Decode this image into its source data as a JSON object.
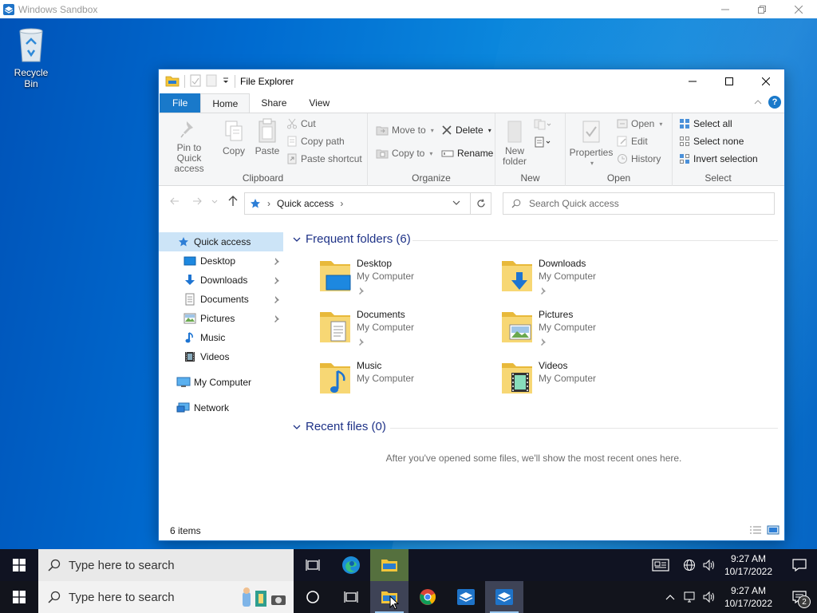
{
  "host": {
    "title": "Windows Sandbox",
    "controls": [
      "minimize",
      "restore",
      "close"
    ]
  },
  "desktop": {
    "icons": [
      {
        "label": "Recycle Bin",
        "icon": "recycle-bin-icon"
      }
    ]
  },
  "explorer": {
    "title": "File Explorer",
    "tabs": [
      "File",
      "Home",
      "Share",
      "View"
    ],
    "active_tab": "Home",
    "ribbon": {
      "clipboard": {
        "name": "Clipboard",
        "pin": "Pin to Quick access",
        "copy": "Copy",
        "paste": "Paste",
        "cut": "Cut",
        "copy_path": "Copy path",
        "paste_shortcut": "Paste shortcut"
      },
      "organize": {
        "name": "Organize",
        "move_to": "Move to",
        "copy_to": "Copy to",
        "delete": "Delete",
        "rename": "Rename"
      },
      "new": {
        "name": "New",
        "new_folder": "New folder"
      },
      "open": {
        "name": "Open",
        "properties": "Properties",
        "open": "Open",
        "edit": "Edit",
        "history": "History"
      },
      "select": {
        "name": "Select",
        "select_all": "Select all",
        "select_none": "Select none",
        "invert": "Invert selection"
      }
    },
    "address": {
      "path": "Quick access",
      "search_placeholder": "Search Quick access"
    },
    "nav": [
      {
        "label": "Quick access",
        "icon": "star-icon",
        "selected": true,
        "pinned": false
      },
      {
        "label": "Desktop",
        "icon": "desktop-icon",
        "pinned": true
      },
      {
        "label": "Downloads",
        "icon": "download-icon",
        "pinned": true
      },
      {
        "label": "Documents",
        "icon": "document-icon",
        "pinned": true
      },
      {
        "label": "Pictures",
        "icon": "picture-icon",
        "pinned": true
      },
      {
        "label": "Music",
        "icon": "music-icon",
        "pinned": false
      },
      {
        "label": "Videos",
        "icon": "video-icon",
        "pinned": false
      },
      {
        "label": "My Computer",
        "icon": "computer-icon",
        "pinned": false
      },
      {
        "label": "Network",
        "icon": "network-icon",
        "pinned": false
      }
    ],
    "frequent": {
      "heading": "Frequent folders (6)",
      "items": [
        {
          "name": "Desktop",
          "location": "My Computer",
          "pinned": true,
          "icon": "desktop-folder-icon"
        },
        {
          "name": "Downloads",
          "location": "My Computer",
          "pinned": true,
          "icon": "downloads-folder-icon"
        },
        {
          "name": "Documents",
          "location": "My Computer",
          "pinned": true,
          "icon": "documents-folder-icon"
        },
        {
          "name": "Pictures",
          "location": "My Computer",
          "pinned": true,
          "icon": "pictures-folder-icon"
        },
        {
          "name": "Music",
          "location": "My Computer",
          "pinned": false,
          "icon": "music-folder-icon"
        },
        {
          "name": "Videos",
          "location": "My Computer",
          "pinned": false,
          "icon": "videos-folder-icon"
        }
      ]
    },
    "recent": {
      "heading": "Recent files (0)",
      "empty_message": "After you've opened some files, we'll show the most recent ones here."
    },
    "status": "6 items"
  },
  "taskbar_top": {
    "search_placeholder": "Type here to search",
    "apps": [
      "task-view-icon",
      "edge-icon",
      "file-explorer-icon"
    ],
    "time": "9:27 AM",
    "date": "10/17/2022"
  },
  "taskbar_bottom": {
    "search_placeholder": "Type here to search",
    "apps": [
      "cortana-icon",
      "task-view-icon",
      "file-explorer-icon",
      "chrome-icon",
      "sandbox-icon",
      "sandbox-icon"
    ],
    "time": "9:27 AM",
    "date": "10/17/2022",
    "notification_count": "2"
  },
  "colors": {
    "accent": "#1979ca",
    "selection": "#cce4f7",
    "heading": "#1e3287",
    "taskbar": "#101322"
  }
}
